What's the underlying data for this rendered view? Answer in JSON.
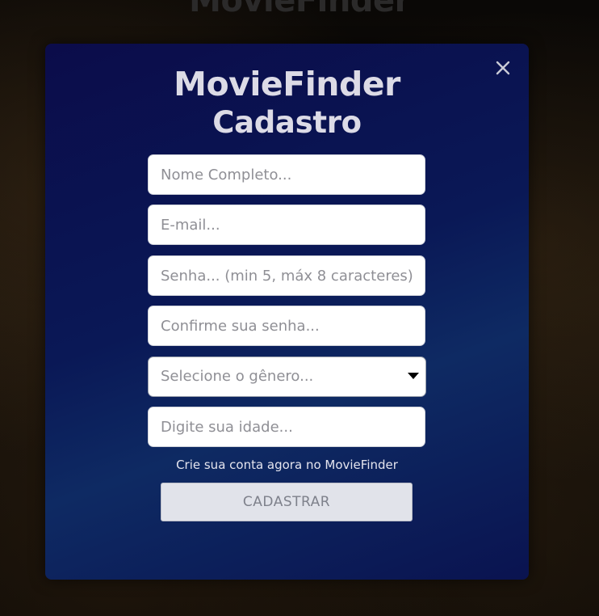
{
  "app": {
    "background_title": "MovieFinder"
  },
  "modal": {
    "title": "MovieFinder",
    "subtitle": "Cadastro",
    "close_icon": "close-icon",
    "fields": {
      "full_name_placeholder": "Nome Completo...",
      "email_placeholder": "E-mail...",
      "password_placeholder": "Senha... (min 5, máx 8 caracteres)",
      "confirm_password_placeholder": "Confirme sua senha...",
      "gender_select_value": "Selecione o gênero...",
      "age_placeholder": "Digite sua idade..."
    },
    "tagline": "Crie sua conta agora no MovieFinder",
    "submit_label": "CADASTRAR"
  },
  "colors": {
    "modal_gradient_start": "#0b0c4a",
    "modal_gradient_mid": "#0e2a63",
    "title_text": "#dcdbe6",
    "button_bg": "#e1e3ea",
    "button_text": "#7e818b"
  }
}
